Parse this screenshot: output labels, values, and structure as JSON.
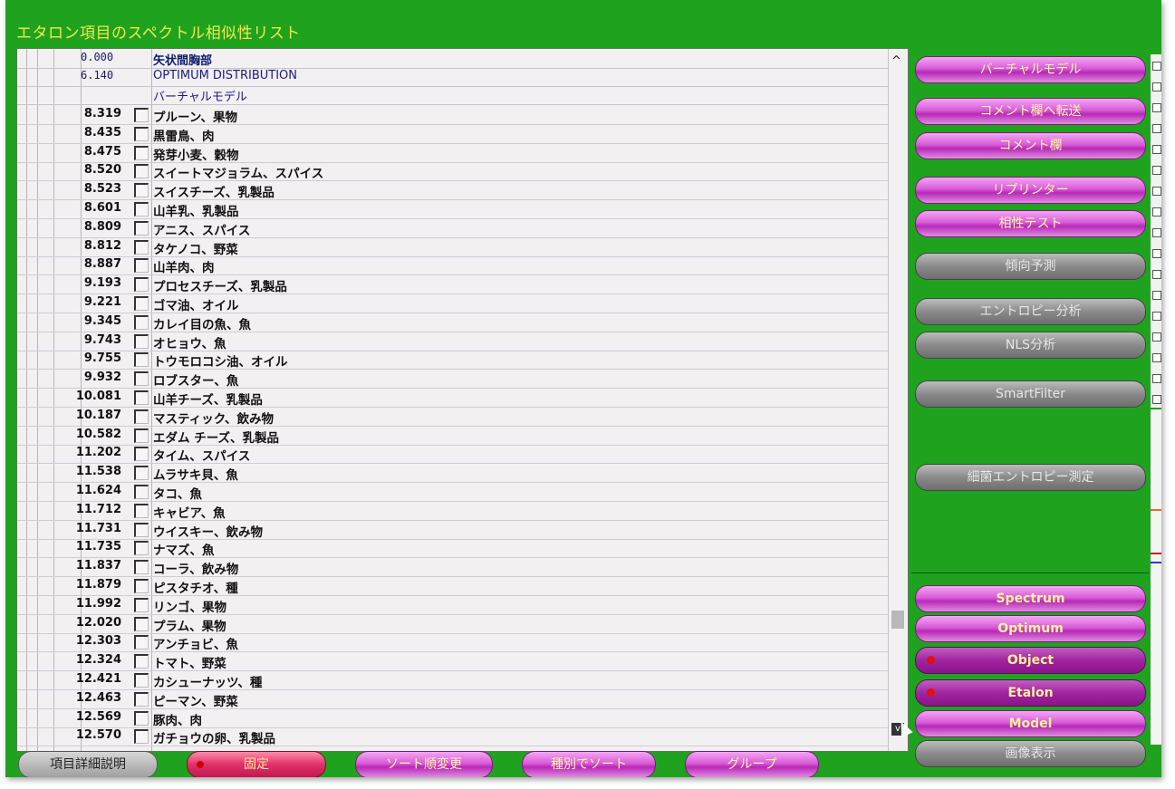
{
  "window": {
    "title": "エタロン項目のスペクトル相似性リスト"
  },
  "header_rows": [
    {
      "value": "0.000",
      "name": "矢状間胸部",
      "bold": true
    },
    {
      "value": "6.140",
      "name": "OPTIMUM DISTRIBUTION",
      "bold": false
    },
    {
      "value": "",
      "name": "バーチャルモデル",
      "bold": false
    }
  ],
  "rows": [
    {
      "value": "8.319",
      "name": "プルーン、果物"
    },
    {
      "value": "8.435",
      "name": "黒雷鳥、肉"
    },
    {
      "value": "8.475",
      "name": "発芽小麦、穀物"
    },
    {
      "value": "8.520",
      "name": "スイートマジョラム、スパイス"
    },
    {
      "value": "8.523",
      "name": "スイスチーズ、乳製品"
    },
    {
      "value": "8.601",
      "name": "山羊乳、乳製品"
    },
    {
      "value": "8.809",
      "name": "アニス、スパイス"
    },
    {
      "value": "8.812",
      "name": "タケノコ、野菜"
    },
    {
      "value": "8.887",
      "name": "山羊肉、肉"
    },
    {
      "value": "9.193",
      "name": "プロセスチーズ、乳製品"
    },
    {
      "value": "9.221",
      "name": "ゴマ油、オイル"
    },
    {
      "value": "9.345",
      "name": "カレイ目の魚、魚"
    },
    {
      "value": "9.743",
      "name": "オヒョウ、魚"
    },
    {
      "value": "9.755",
      "name": "トウモロコシ油、オイル"
    },
    {
      "value": "9.932",
      "name": "ロブスター、魚"
    },
    {
      "value": "10.081",
      "name": "山羊チーズ、乳製品"
    },
    {
      "value": "10.187",
      "name": "マスティック、飲み物"
    },
    {
      "value": "10.582",
      "name": "エダム チーズ、乳製品"
    },
    {
      "value": "11.202",
      "name": "タイム、スパイス"
    },
    {
      "value": "11.538",
      "name": "ムラサキ貝、魚"
    },
    {
      "value": "11.624",
      "name": "タコ、魚"
    },
    {
      "value": "11.712",
      "name": "キャビア、魚"
    },
    {
      "value": "11.731",
      "name": "ウイスキー、飲み物"
    },
    {
      "value": "11.735",
      "name": "ナマズ、魚"
    },
    {
      "value": "11.837",
      "name": "コーラ、飲み物"
    },
    {
      "value": "11.879",
      "name": "ピスタチオ、種"
    },
    {
      "value": "11.992",
      "name": "リンゴ、果物"
    },
    {
      "value": "12.020",
      "name": "プラム、果物"
    },
    {
      "value": "12.303",
      "name": "アンチョビ、魚"
    },
    {
      "value": "12.324",
      "name": "トマト、野菜"
    },
    {
      "value": "12.421",
      "name": "カシューナッツ、種"
    },
    {
      "value": "12.463",
      "name": "ピーマン、野菜"
    },
    {
      "value": "12.569",
      "name": "豚肉、肉"
    },
    {
      "value": "12.570",
      "name": "ガチョウの卵、乳製品"
    }
  ],
  "right_buttons": [
    {
      "id": "virtual-model",
      "label": "バーチャルモデル",
      "style": "pink"
    },
    {
      "id": "transfer-comment",
      "label": "コメント欄へ転送",
      "style": "pink"
    },
    {
      "id": "comment",
      "label": "コメント欄",
      "style": "pink"
    },
    {
      "id": "reprinter",
      "label": "リプリンター",
      "style": "pink"
    },
    {
      "id": "compat-test",
      "label": "相性テスト",
      "style": "pink"
    },
    {
      "id": "trend",
      "label": "傾向予測",
      "style": "gray"
    },
    {
      "id": "entropy",
      "label": "エントロピー分析",
      "style": "gray"
    },
    {
      "id": "nls",
      "label": "NLS分析",
      "style": "gray"
    },
    {
      "id": "smartfilter",
      "label": "SmartFilter",
      "style": "gray"
    },
    {
      "id": "bacteria",
      "label": "細菌エントロピー測定",
      "style": "gray"
    },
    {
      "id": "spectrum",
      "label": "Spectrum",
      "style": "pinkbold"
    },
    {
      "id": "optimum",
      "label": "Optimum",
      "style": "pinkbold"
    },
    {
      "id": "object",
      "label": "Object",
      "style": "dark"
    },
    {
      "id": "etalon",
      "label": "Etalon",
      "style": "dark"
    },
    {
      "id": "model",
      "label": "Model",
      "style": "pinkbold"
    },
    {
      "id": "image-view",
      "label": "画像表示",
      "style": "gray"
    }
  ],
  "bottom_buttons": [
    {
      "id": "item-detail",
      "label": "項目詳細説明",
      "style": "gray"
    },
    {
      "id": "fix",
      "label": "固定",
      "style": "red"
    },
    {
      "id": "sort-order",
      "label": "ソート順変更",
      "style": "pink"
    },
    {
      "id": "sort-type",
      "label": "種別でソート",
      "style": "pink"
    },
    {
      "id": "group",
      "label": "グループ",
      "style": "pink"
    }
  ],
  "colors": {
    "background": "#1fa31f",
    "title": "#f2e84a",
    "button_pink": "#d85cd8",
    "button_gray": "#8a8a8a"
  }
}
